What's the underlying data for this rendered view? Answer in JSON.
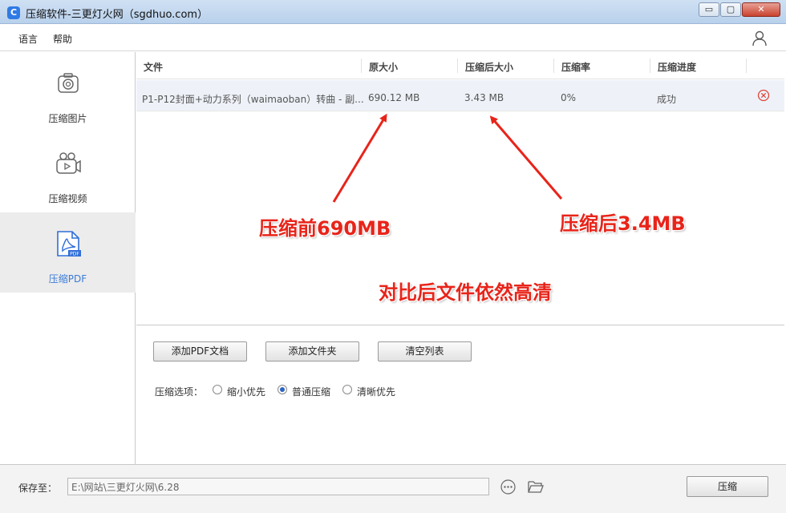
{
  "window": {
    "title": "压缩软件-三更灯火网（sgdhuo.com）",
    "logo_letter": "C",
    "controls": {
      "minimize": "▭",
      "maximize": "▢",
      "close": "✕"
    }
  },
  "menu": {
    "language": "语言",
    "help": "帮助",
    "user_icon": "user-icon"
  },
  "sidebar": {
    "items": [
      {
        "label": "压缩图片",
        "icon": "image-compress-icon",
        "active": false
      },
      {
        "label": "压缩视频",
        "icon": "video-compress-icon",
        "active": false
      },
      {
        "label": "压缩PDF",
        "icon": "pdf-compress-icon",
        "active": true
      }
    ]
  },
  "table": {
    "headers": {
      "file": "文件",
      "original_size": "原大小",
      "compressed_size": "压缩后大小",
      "ratio": "压缩率",
      "progress": "压缩进度"
    },
    "rows": [
      {
        "file": "P1-P12封面+动力系列（waimaoban）转曲 - 副...",
        "original_size": "690.12 MB",
        "compressed_size": "3.43 MB",
        "ratio": "0%",
        "progress": "成功"
      }
    ]
  },
  "annotations": {
    "before": "压缩前690MB",
    "after": "压缩后3.4MB",
    "note": "对比后文件依然高清",
    "color": "#e8241a"
  },
  "buttons": {
    "add_pdf": "添加PDF文档",
    "add_folder": "添加文件夹",
    "clear_list": "清空列表",
    "compress": "压缩"
  },
  "options": {
    "label": "压缩选项：",
    "choices": [
      {
        "label": "缩小优先",
        "checked": false
      },
      {
        "label": "普通压缩",
        "checked": true
      },
      {
        "label": "清晰优先",
        "checked": false
      }
    ]
  },
  "footer": {
    "save_label": "保存至：",
    "save_path": "E:\\网站\\三更灯火网\\6.28"
  },
  "colors": {
    "accent": "#3b7bd8",
    "pdf_icon": "#2f6fd8"
  }
}
